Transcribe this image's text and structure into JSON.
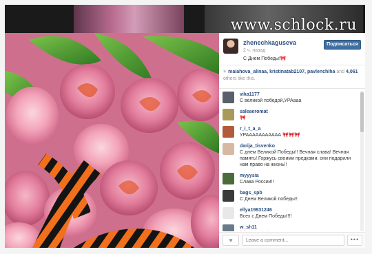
{
  "watermark": "www.schlock.ru",
  "post": {
    "username": "zhenechkaguseva",
    "time": "2 ч. назад",
    "caption": "С Днем Победы!🎀",
    "follow_label": "Подписаться"
  },
  "likes": {
    "names": "maiahova_alinaa, kristinatab2107, pavlenchiha",
    "and_text": "and",
    "count": "4,061",
    "others_text": "others like this."
  },
  "comments": [
    {
      "user": "vika1177",
      "text": "С великой победой,УРАааа",
      "avatar_color": "#5b5f6b"
    },
    {
      "user": "saleaeromat",
      "text": "🎀",
      "avatar_color": "#a99a5a"
    },
    {
      "user": "r_i_t_a_a",
      "text": "УРААААААААААА 🎀🎀🎀",
      "avatar_color": "#b35a3a"
    },
    {
      "user": "darija_tisvenko",
      "text": "С днем Великой Победы!! Вечная слава! Вечная память! Горжусь своими предками, они подарили нам право на жизнь!!",
      "avatar_color": "#d7b9a3"
    },
    {
      "user": "myyysia",
      "text": "Слава России!!",
      "avatar_color": "#4c6b3a"
    },
    {
      "user": "bags_spb",
      "text": "С Днем Великой победы!!",
      "avatar_color": "#3a3a3a"
    },
    {
      "user": "ellya19931246",
      "text": "Всех с Днем Победы!!!!",
      "avatar_color": "#e8e8e8"
    },
    {
      "user": "w_sh11",
      "text": "🎀👏👏👏👏",
      "avatar_color": "#6a7a8a"
    }
  ],
  "comment_input": {
    "placeholder": "Leave a comment..."
  },
  "icons": {
    "heart": "♥",
    "more": "•••"
  }
}
